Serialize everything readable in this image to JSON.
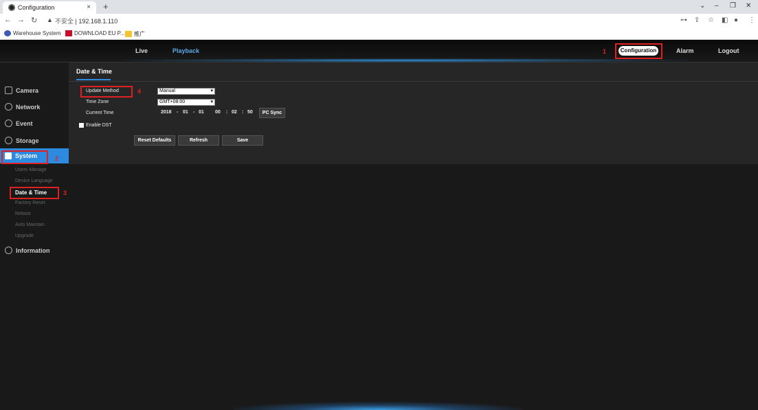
{
  "browser": {
    "tab_title": "Configuration",
    "tab_close": "×",
    "new_tab": "+",
    "insecure_label": "不安全",
    "url": "192.168.1.110",
    "bookmarks": [
      {
        "label": "Warehouse System"
      },
      {
        "label": "DOWNLOAD EU P..."
      },
      {
        "label": "推广"
      }
    ]
  },
  "topnav": {
    "live": "Live",
    "playback": "Playback",
    "configuration": "Configuration",
    "alarm": "Alarm",
    "logout": "Logout"
  },
  "annotations": {
    "n1": "1",
    "n2": "2",
    "n3": "3",
    "n4": "4"
  },
  "sidebar": {
    "camera": "Camera",
    "network": "Network",
    "event": "Event",
    "storage": "Storage",
    "system": "System",
    "information": "Information",
    "system_sub": [
      "Users Manage",
      "Device Language",
      "Date & Time",
      "Factory Reset",
      "Reboot",
      "Auto Maintain",
      "Upgrade"
    ]
  },
  "panel": {
    "title": "Date & Time",
    "update_method_label": "Update Method",
    "update_method_value": "Manual",
    "time_zone_label": "Time Zone",
    "time_zone_value": "GMT+08:00",
    "current_time_label": "Current Time",
    "year": "2018",
    "month": "01",
    "day": "01",
    "hour": "00",
    "minute": "02",
    "second": "50",
    "dash": "-",
    "colon": ":",
    "pc_sync": "PC Sync",
    "enable_dst": "Enable DST",
    "reset_defaults": "Reset Defaults",
    "refresh": "Refresh",
    "save": "Save"
  },
  "colors": {
    "accent": "#2c8be0",
    "highlight": "#e32020"
  }
}
